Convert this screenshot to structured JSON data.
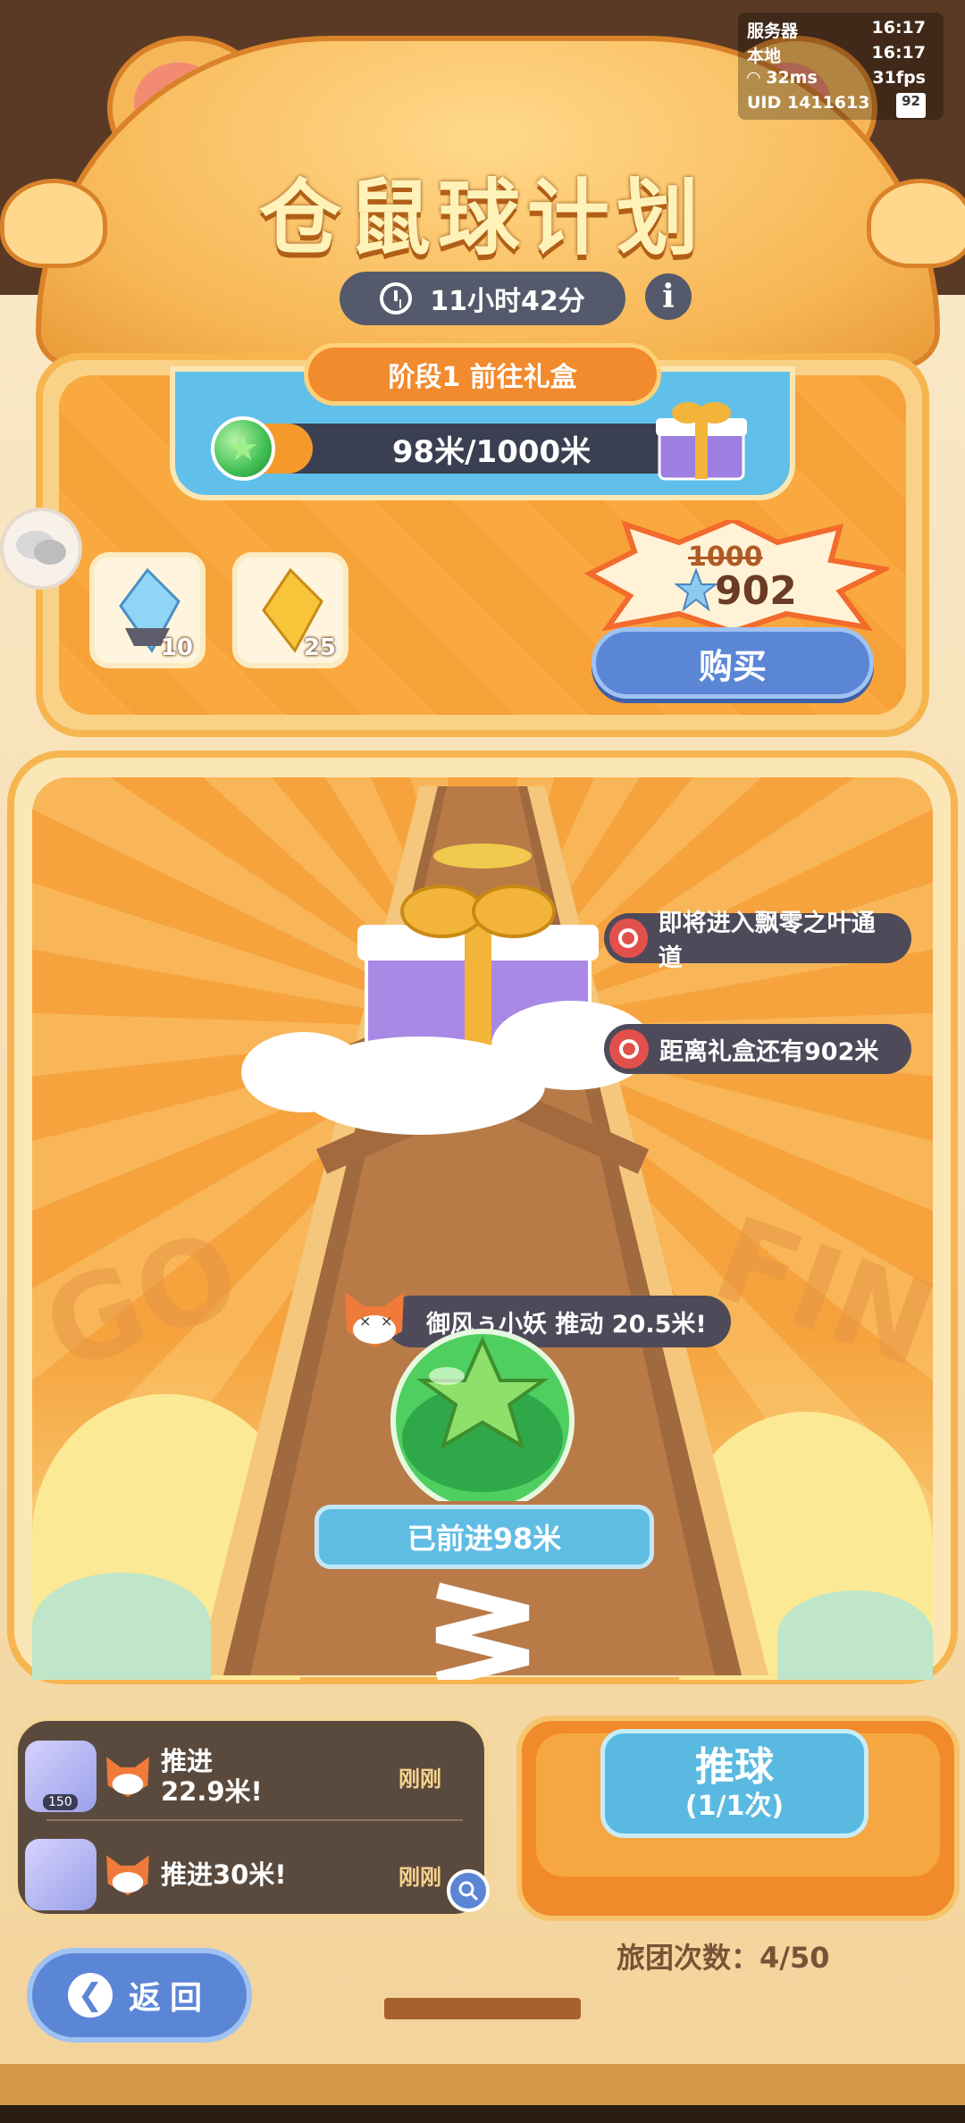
{
  "hud": {
    "server_label": "服务器",
    "server_time": "16:17",
    "local_label": "本地",
    "local_time": "16:17",
    "ping": "32ms",
    "fps": "31fps",
    "uid": "UID 1411613",
    "battery": "92"
  },
  "header": {
    "title": "仓鼠球计划",
    "timer": "11小时42分",
    "info_icon": "i"
  },
  "stage": {
    "label": "阶段1 前往礼盒",
    "progress_text": "98米/1000米",
    "progress_fraction": 0.098
  },
  "shop": {
    "items": [
      {
        "icon": "blue-crystal-icon",
        "count": "10"
      },
      {
        "icon": "gold-crystal-icon",
        "count": "25"
      }
    ],
    "old_price": "1000",
    "new_price": "902",
    "buy_label": "购买"
  },
  "track": {
    "tips": [
      "即将进入飘零之叶通道",
      "距离礼盒还有902米"
    ],
    "push_message": "御风ぅ小妖 推动 20.5米!",
    "advanced_label": "已前进98米",
    "bg_text_left": "GO",
    "bg_text_right": "FIN"
  },
  "log": [
    {
      "level": "150",
      "text": "推进\n22.9米!",
      "time": "刚刚"
    },
    {
      "level": "",
      "text": "推进30米!",
      "time": "刚刚"
    }
  ],
  "push_button": {
    "label": "推球",
    "sub_label": "(1/1次)"
  },
  "team_count": "旅团次数：4/50",
  "back_button": {
    "label": "返回"
  },
  "colors": {
    "accent_orange": "#f28a2e",
    "accent_blue": "#5b86d6",
    "track_blue": "#61c0ea"
  }
}
